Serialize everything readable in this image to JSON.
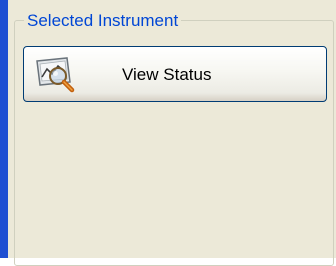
{
  "group": {
    "title": "Selected Instrument"
  },
  "view_status_button": {
    "label": "View Status",
    "icon": "magnifier-chart-icon"
  },
  "colors": {
    "accent_bar": "#1e4fd2",
    "group_title": "#0046d5",
    "panel_bg": "#ece9d8",
    "button_border": "#003c74"
  }
}
